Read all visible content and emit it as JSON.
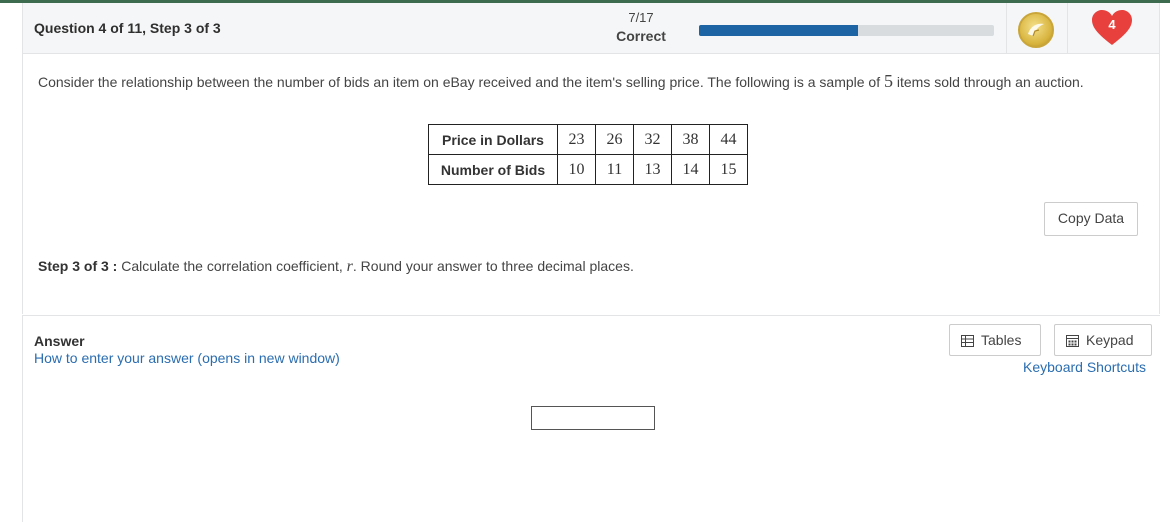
{
  "header": {
    "question_label": "Question 4 of 11, Step 3 of 3",
    "score_fraction": "7/17",
    "score_status": "Correct",
    "progress_fraction": 0.54,
    "lives": "4",
    "colors": {
      "progress": "#1c64a4",
      "heart": "#e8413d"
    }
  },
  "problem": {
    "intro_before": "Consider the relationship between the number of bids an item on eBay received and the item's selling price. The following is a sample of ",
    "intro_num": "5",
    "intro_after": " items sold through an auction.",
    "table": {
      "row1_label": "Price in Dollars",
      "row1": [
        "23",
        "26",
        "32",
        "38",
        "44"
      ],
      "row2_label": "Number of Bids",
      "row2": [
        "10",
        "11",
        "13",
        "14",
        "15"
      ]
    },
    "copy_button": "Copy Data",
    "step_label": "Step 3 of 3 :",
    "step_before": " Calculate the correlation coefficient, ",
    "step_var": "r",
    "step_after": ". Round your answer to three decimal places."
  },
  "answer": {
    "label": "Answer",
    "help_link": "How to enter your answer (opens in new window)",
    "tables_button": "Tables",
    "keypad_button": "Keypad",
    "shortcuts_link": "Keyboard Shortcuts",
    "input_value": ""
  }
}
